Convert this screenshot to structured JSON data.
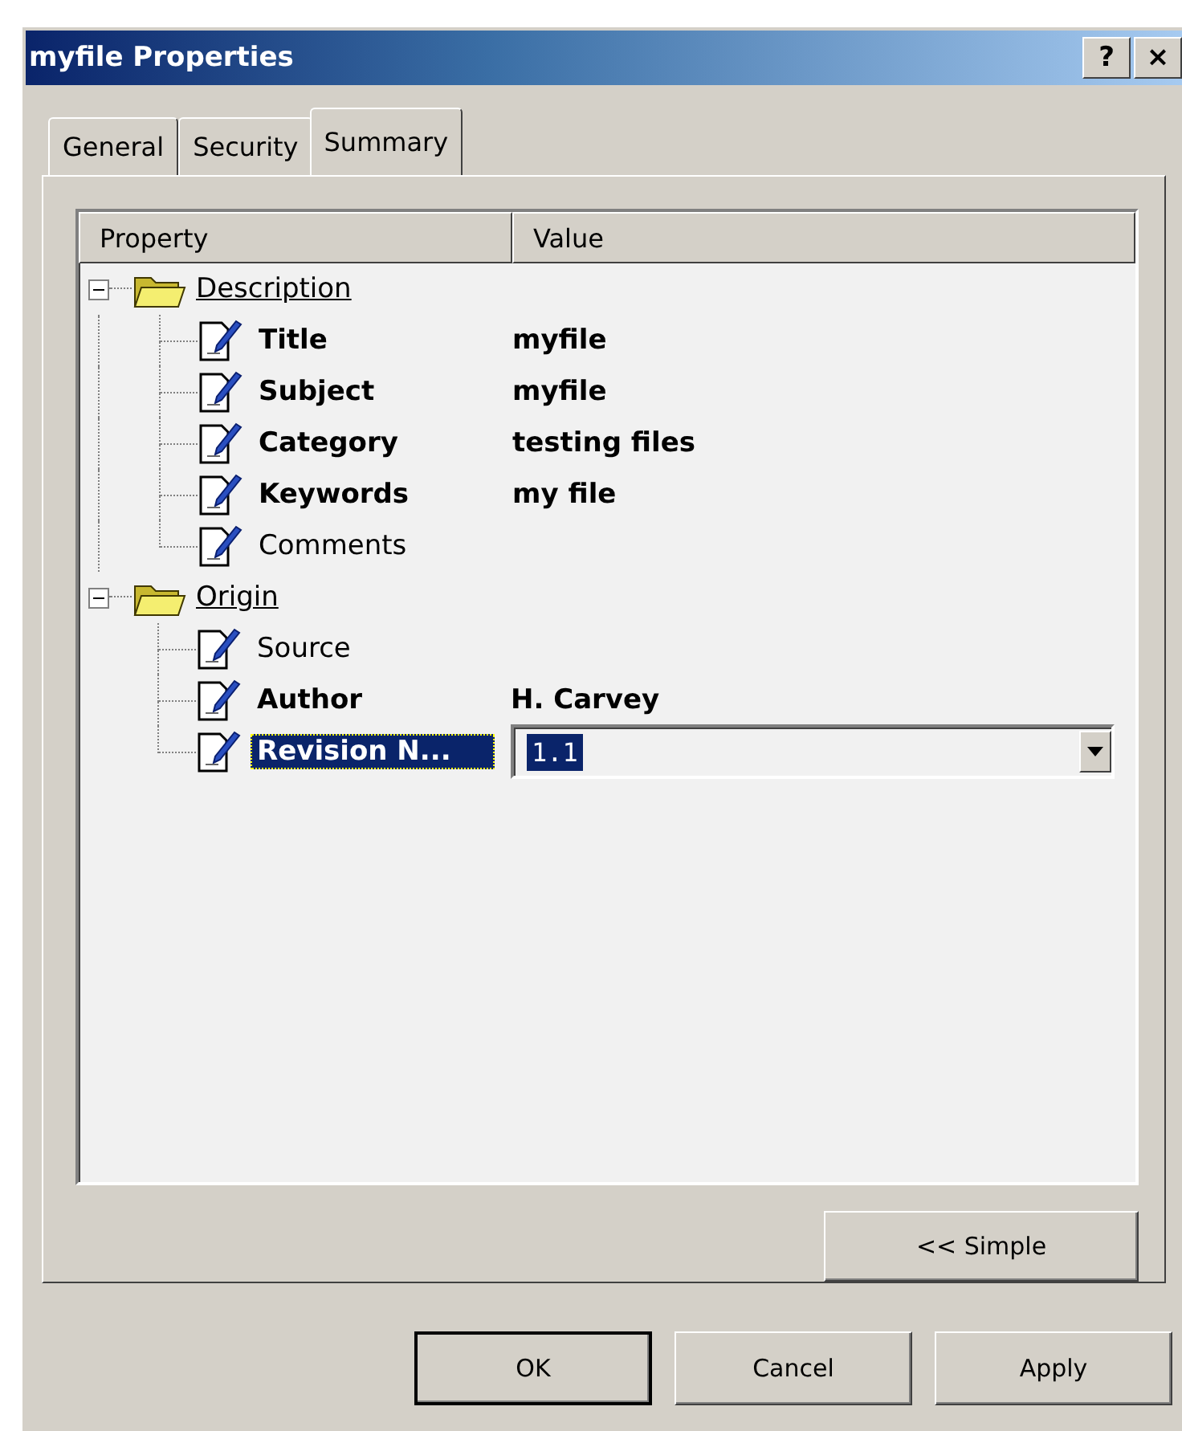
{
  "window": {
    "title": "myfile Properties",
    "help_button": "?",
    "close_button": "×"
  },
  "tabs": [
    {
      "label": "General",
      "selected": false
    },
    {
      "label": "Security",
      "selected": false
    },
    {
      "label": "Summary",
      "selected": true
    }
  ],
  "property_list": {
    "columns": [
      "Property",
      "Value"
    ],
    "groups": [
      {
        "name": "Description",
        "expanded": true,
        "children": [
          {
            "name": "Title",
            "value": "myfile",
            "selected": false,
            "editing": false
          },
          {
            "name": "Subject",
            "value": "myfile",
            "selected": false,
            "editing": false
          },
          {
            "name": "Category",
            "value": "testing files",
            "selected": false,
            "editing": false
          },
          {
            "name": "Keywords",
            "value": "my file",
            "selected": false,
            "editing": false
          },
          {
            "name": "Comments",
            "selected": false,
            "editing": false
          }
        ]
      },
      {
        "name": "Origin",
        "expanded": true,
        "children": [
          {
            "name": "Source",
            "selected": false,
            "editing": false
          },
          {
            "name": "Author",
            "value": "H. Carvey",
            "selected": false,
            "editing": false
          },
          {
            "name": "Revision N...",
            "value": "1.1",
            "selected": true,
            "editing": true
          }
        ]
      }
    ]
  },
  "simple_button": {
    "label": "<< Simple"
  },
  "buttons": [
    {
      "label": "OK",
      "default": true
    },
    {
      "label": "Cancel",
      "default": false
    },
    {
      "label": "Apply",
      "default": false
    }
  ]
}
